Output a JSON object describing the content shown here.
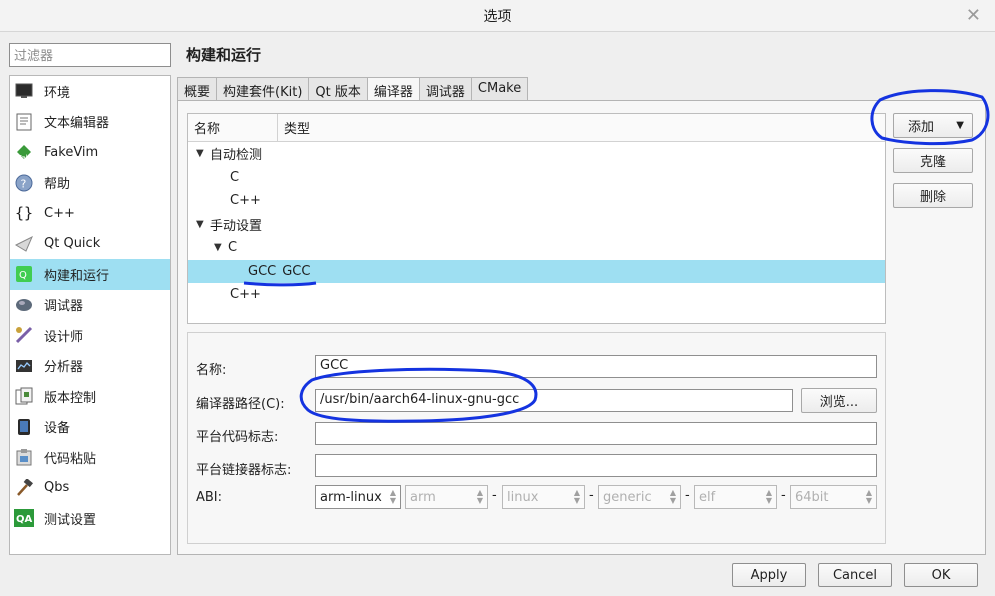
{
  "window": {
    "title": "选项"
  },
  "filter": {
    "placeholder": "过滤器"
  },
  "sidebar": {
    "items": [
      {
        "label": "环境",
        "icon": "monitor-icon"
      },
      {
        "label": "文本编辑器",
        "icon": "text-document-icon"
      },
      {
        "label": "FakeVim",
        "icon": "fakevim-icon"
      },
      {
        "label": "帮助",
        "icon": "help-icon"
      },
      {
        "label": "C++",
        "icon": "braces-icon"
      },
      {
        "label": "Qt Quick",
        "icon": "qt-quick-icon"
      },
      {
        "label": "构建和运行",
        "icon": "build-run-icon",
        "selected": true
      },
      {
        "label": "调试器",
        "icon": "debugger-icon"
      },
      {
        "label": "设计师",
        "icon": "designer-icon"
      },
      {
        "label": "分析器",
        "icon": "analyzer-icon"
      },
      {
        "label": "版本控制",
        "icon": "version-control-icon"
      },
      {
        "label": "设备",
        "icon": "device-icon"
      },
      {
        "label": "代码粘贴",
        "icon": "code-paste-icon"
      },
      {
        "label": "Qbs",
        "icon": "hammer-icon"
      },
      {
        "label": "测试设置",
        "icon": "qa-icon"
      }
    ]
  },
  "panel": {
    "title": "构建和运行"
  },
  "tabs": [
    "概要",
    "构建套件(Kit)",
    "Qt 版本",
    "编译器",
    "调试器",
    "CMake"
  ],
  "tree": {
    "col_name": "名称",
    "col_type": "类型",
    "auto": "自动检测",
    "auto_c": "C",
    "auto_cpp": "C++",
    "manual": "手动设置",
    "manual_c": "C",
    "gcc_name": "GCC",
    "gcc_type": "GCC",
    "manual_cpp": "C++"
  },
  "buttons": {
    "add": "添加",
    "clone": "克隆",
    "remove": "删除",
    "browse": "浏览..."
  },
  "form": {
    "name_label": "名称:",
    "name_value": "GCC",
    "path_label": "编译器路径(C):",
    "path_value": "/usr/bin/aarch64-linux-gnu-gcc",
    "platform_code_label": "平台代码标志:",
    "platform_code_value": "",
    "platform_link_label": "平台链接器标志:",
    "platform_link_value": "",
    "abi_label": "ABI:",
    "abi": [
      "arm-linux",
      "arm",
      "linux",
      "generic",
      "elf",
      "64bit"
    ]
  },
  "footer": {
    "apply": "Apply",
    "cancel": "Cancel",
    "ok": "OK"
  },
  "colors": {
    "selection": "#9edff2",
    "annotation": "#1433e0"
  }
}
